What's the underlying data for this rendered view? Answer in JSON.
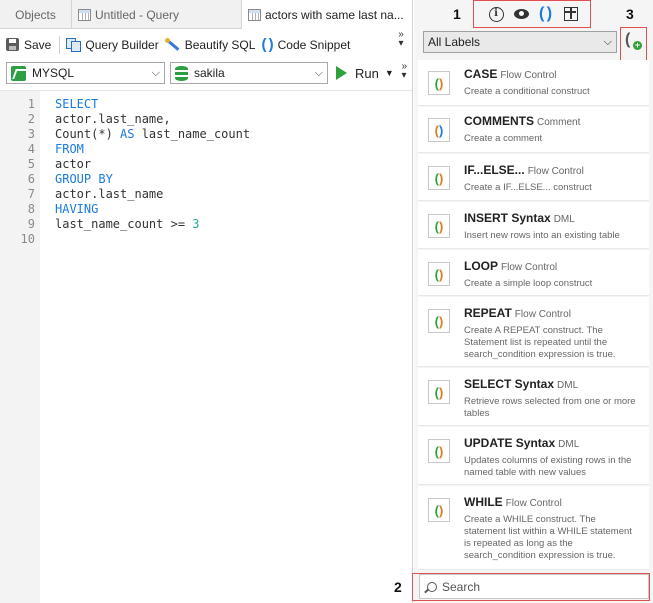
{
  "tabs": [
    {
      "label": "Objects"
    },
    {
      "label": "Untitled - Query"
    },
    {
      "label": "actors with same last na..."
    }
  ],
  "toolbar": {
    "save_label": "Save",
    "query_builder_label": "Query Builder",
    "beautify_label": "Beautify SQL",
    "code_snippet_label": "Code Snippet",
    "more": "»"
  },
  "connection": {
    "value": "MYSQL"
  },
  "database": {
    "value": "sakila"
  },
  "run_label": "Run",
  "editor": {
    "line_numbers": [
      "1",
      "2",
      "3",
      "4",
      "5",
      "6",
      "7",
      "8",
      "9",
      "10"
    ]
  },
  "snippets_panel": {
    "filter": "All Labels",
    "search_placeholder": "Search",
    "items": [
      {
        "title": "CASE",
        "category": "Flow Control",
        "desc": "Create a conditional construct"
      },
      {
        "title": "COMMENTS",
        "category": "Comment",
        "desc": "Create a comment"
      },
      {
        "title": "IF...ELSE...",
        "category": "Flow Control",
        "desc": "Create a IF...ELSE... construct"
      },
      {
        "title": "INSERT Syntax",
        "category": "DML",
        "desc": "Insert new rows into an existing table"
      },
      {
        "title": "LOOP",
        "category": "Flow Control",
        "desc": "Create a simple loop construct"
      },
      {
        "title": "REPEAT",
        "category": "Flow Control",
        "desc": "Create A REPEAT construct. The Statement list is repeated until the search_condition expression is true."
      },
      {
        "title": "SELECT Syntax",
        "category": "DML",
        "desc": "Retrieve rows selected from one or more tables"
      },
      {
        "title": "UPDATE Syntax",
        "category": "DML",
        "desc": "Updates columns of existing rows in the named table with new values"
      },
      {
        "title": "WHILE",
        "category": "Flow Control",
        "desc": "Create a WHILE construct. The statement list within a WHILE statement is repeated as long as the search_condition expression is true."
      }
    ]
  },
  "markers": {
    "m1": "1",
    "m2": "2",
    "m3": "3"
  },
  "colors": {
    "keyword": "#1a7be0",
    "highlight": "#e05050",
    "run": "#2fa13a"
  }
}
